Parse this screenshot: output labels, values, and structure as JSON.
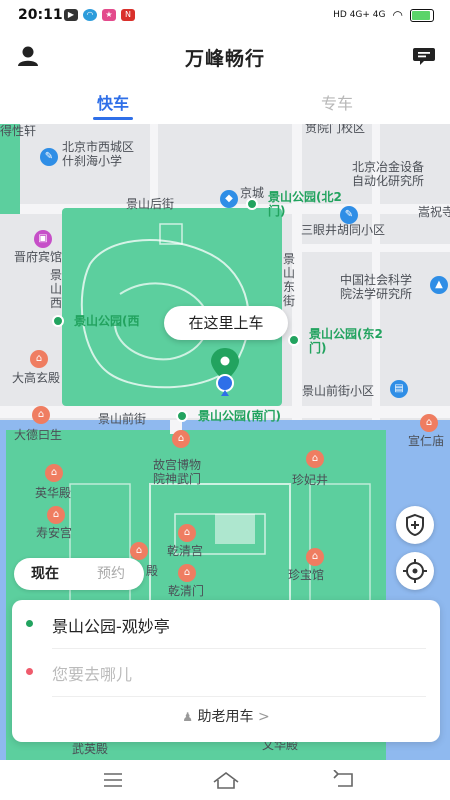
{
  "status_bar": {
    "time": "20:11",
    "network": "HD 4G+ 4G",
    "battery_level": 0.8,
    "battery_color": "#5bd46a"
  },
  "header": {
    "title": "万峰畅行",
    "user_icon": "user-icon",
    "message_icon": "message-icon"
  },
  "tabs": [
    {
      "label": "快车",
      "active": true
    },
    {
      "label": "专车",
      "active": false
    }
  ],
  "map": {
    "pickup_bubble": "在这里上车",
    "labels": [
      "得性轩",
      "北京市西城区\n什刹海小学",
      "贯院门校区",
      "北京冶金设备\n自动化研究所",
      "景山后街",
      "京城",
      "三眼井胡同小区",
      "嵩祝寺",
      "晋府宾馆",
      "景\n山\n西",
      "景\n山\n东\n街",
      "中国社会科学\n院法学研究所",
      "大高玄殿",
      "景山前街小区",
      "景山前街",
      "大德曰生",
      "宣仁庙",
      "故宫博物\n院神武门",
      "珍妃井",
      "英华殿",
      "寿安宫",
      "乾清宫",
      "殿",
      "乾清门",
      "珍宝馆",
      "武英殿",
      "文华殿"
    ],
    "pois": [
      "景山公园(北2\n门)",
      "景山公园(西",
      "景山公园(东2\n门)",
      "景山公园(南门)"
    ],
    "accent_color": "#22a35f",
    "water_color": "#8fb9ef",
    "park_color": "#5ccf9e"
  },
  "ride_time": {
    "now": "现在",
    "later": "预约"
  },
  "trip_card": {
    "pickup": "景山公园-观妙亭",
    "destination_placeholder": "您要去哪儿",
    "elder_mode": "助老用车"
  },
  "nav_bar": {
    "menu_icon": "menu-icon",
    "home_icon": "home-icon",
    "back_icon": "back-icon"
  }
}
